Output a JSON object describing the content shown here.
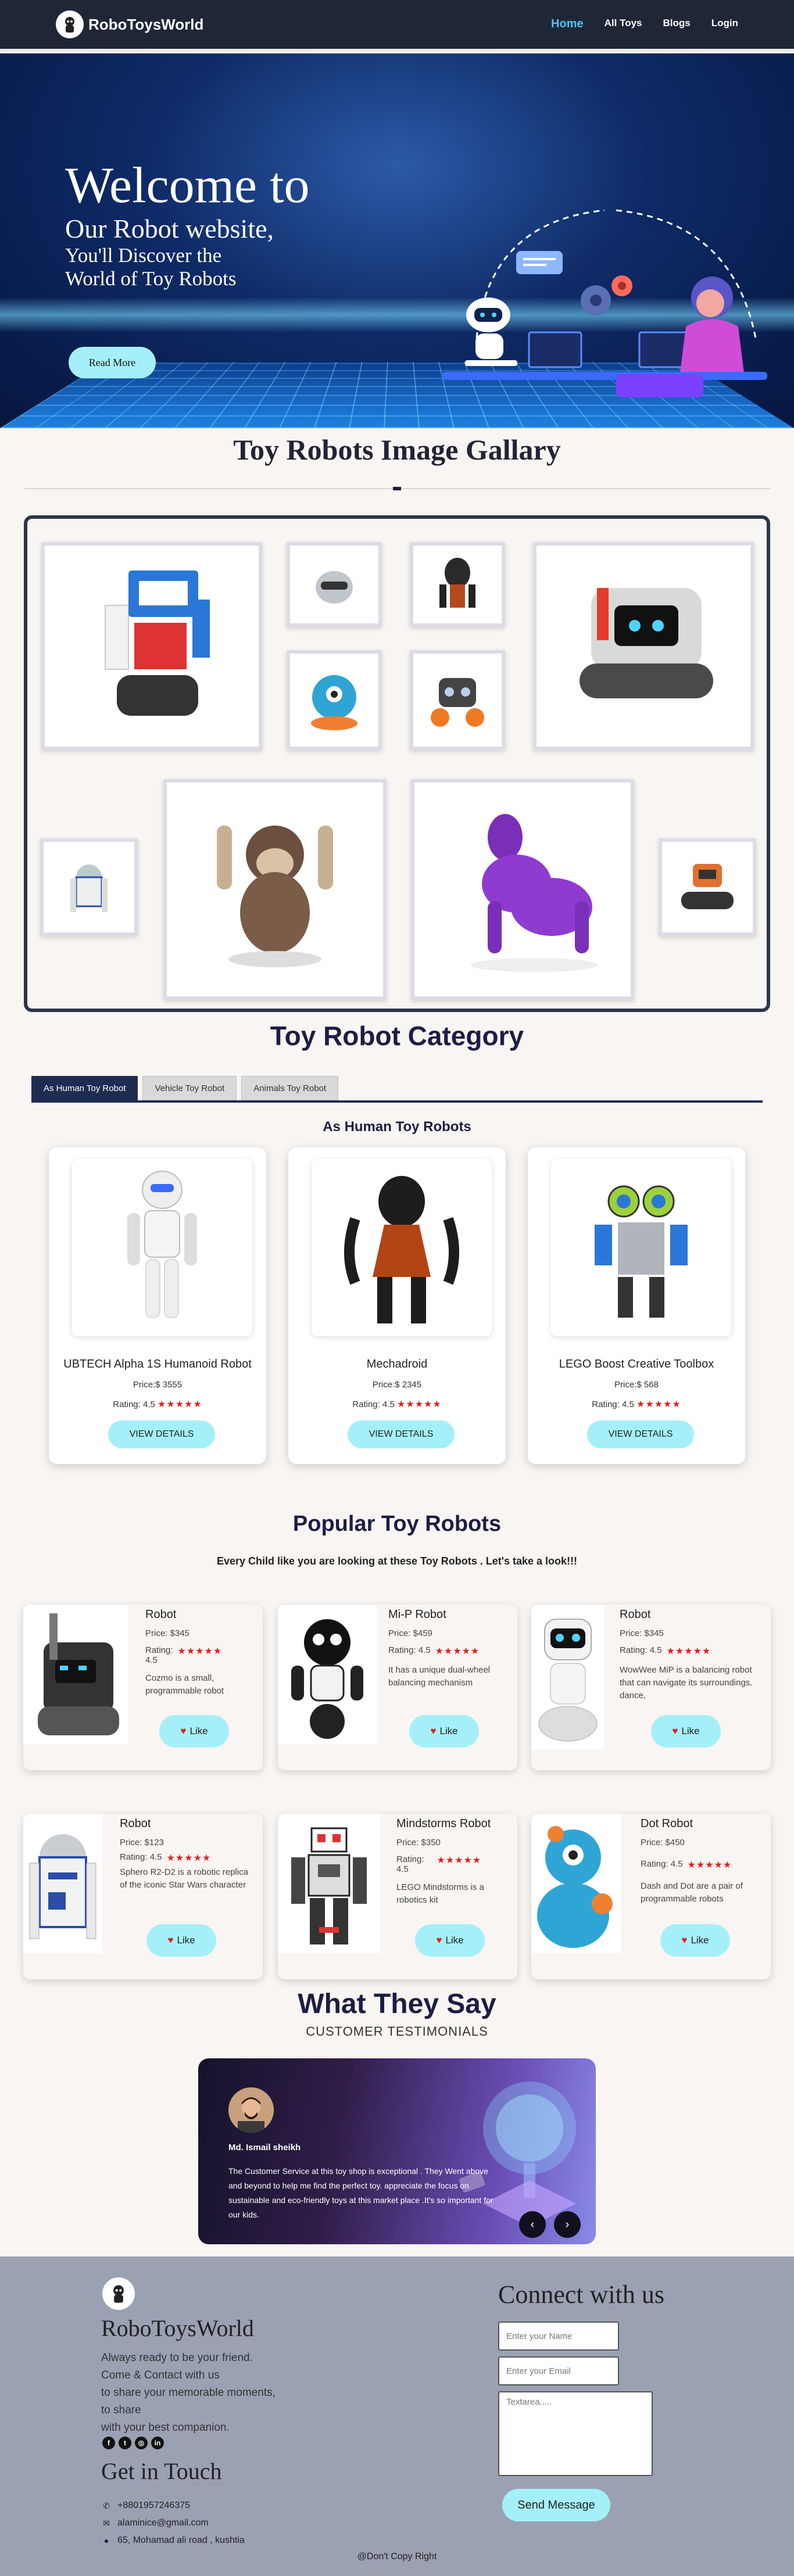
{
  "nav": {
    "brand": "RoboToysWorld",
    "links": [
      "Home",
      "All Toys",
      "Blogs",
      "Login"
    ]
  },
  "hero": {
    "line1": "Welcome to",
    "line2": "Our Robot website,",
    "line3": "You'll Discover the",
    "line4": "World of Toy Robots",
    "button": "Read More"
  },
  "gallery": {
    "title": "Toy Robots Image Gallary",
    "dash": "-"
  },
  "category": {
    "title": "Toy Robot Category",
    "tabs": [
      "As Human Toy Robot",
      "Vehicle Toy Robot",
      "Animals Toy Robot"
    ],
    "subtitle": "As Human Toy Robots",
    "cards": [
      {
        "name": "UBTECH Alpha 1S Humanoid Robot",
        "price": "Price:$ 3555",
        "rating": "Rating: 4.5",
        "stars": "★★★★★",
        "button": "VIEW DETAILS"
      },
      {
        "name": "Mechadroid",
        "price": "Price:$ 2345",
        "rating": "Rating: 4.5",
        "stars": "★★★★★",
        "button": "VIEW DETAILS"
      },
      {
        "name": "LEGO Boost Creative Toolbox",
        "price": "Price:$ 568",
        "rating": "Rating: 4.5",
        "stars": "★★★★★",
        "button": "VIEW DETAILS"
      }
    ]
  },
  "popular": {
    "title": "Popular Toy Robots",
    "subtitle": "Every Child like you are looking at these Toy Robots . Let's take a look!!!",
    "like": "Like",
    "items": [
      {
        "name": "Robot",
        "price": "Price: $345",
        "rating": "Rating:",
        "rating_val": "4.5",
        "stars": "★★★★★",
        "desc": "Cozmo is a small, programmable robot"
      },
      {
        "name": "Mi-P Robot",
        "price": "Price: $459",
        "rating": "Rating: 4.5",
        "rating_val": "",
        "stars": "★★★★★",
        "desc": "It has a unique dual-wheel balancing mechanism"
      },
      {
        "name": "Robot",
        "price": "Price: $345",
        "rating": "Rating: 4.5",
        "rating_val": "",
        "stars": "★★★★★",
        "desc": "WowWee MiP is a balancing robot that can navigate its surroundings. dance,"
      },
      {
        "name": "Robot",
        "price": "Price: $123",
        "rating": "Rating: 4.5",
        "rating_val": "",
        "stars": "★★★★★",
        "desc": "Sphero R2-D2 is a robotic replica of the iconic Star Wars character"
      },
      {
        "name": "Mindstorms Robot",
        "price": "Price: $350",
        "rating": "Rating:",
        "rating_val": "4.5",
        "stars": "★★★★★",
        "desc": "LEGO Mindstorms is a robotics kit"
      },
      {
        "name": "Dot Robot",
        "price": "Price: $450",
        "rating": "Rating: 4.5",
        "rating_val": "",
        "stars": "★★★★★",
        "desc": "Dash and Dot are a pair of programmable robots"
      }
    ]
  },
  "testimonials": {
    "title": "What They Say",
    "subtitle": "CUSTOMER TESTIMONIALS",
    "name": "Md. Ismail sheikh",
    "text": "The Customer Service at this toy shop is exceptional . They Went above and beyond to help me find the perfect toy. appreciate the focus on sustainable and eco-friendly toys at this market place .It's so important for our kids.",
    "prev": "‹",
    "next": "›"
  },
  "footer": {
    "brand": "RoboToysWorld",
    "tag1": "Always ready to be your friend.",
    "tag2": "Come & Contact with us",
    "tag3": "to share your memorable moments,",
    "tag4": "to share",
    "tag5": "with your best companion.",
    "touch_title": "Get in Touch",
    "phone": "+8801957246375",
    "email": "alaminice@gmail.com",
    "address": "65, Mohamad ali road , kushtia",
    "connect_title": "Connect with us",
    "name_placeholder": "Enter your Name",
    "email_placeholder": "Enter your Email",
    "text_placeholder": "Textarea.....",
    "send": "Send Message",
    "copyright": "@Don't Copy Right"
  },
  "colors": {
    "nav_bg": "#1f2737",
    "accent_cyan": "#a5f0f8",
    "star_red": "#e02020",
    "footer_bg": "#9aa1b3"
  }
}
